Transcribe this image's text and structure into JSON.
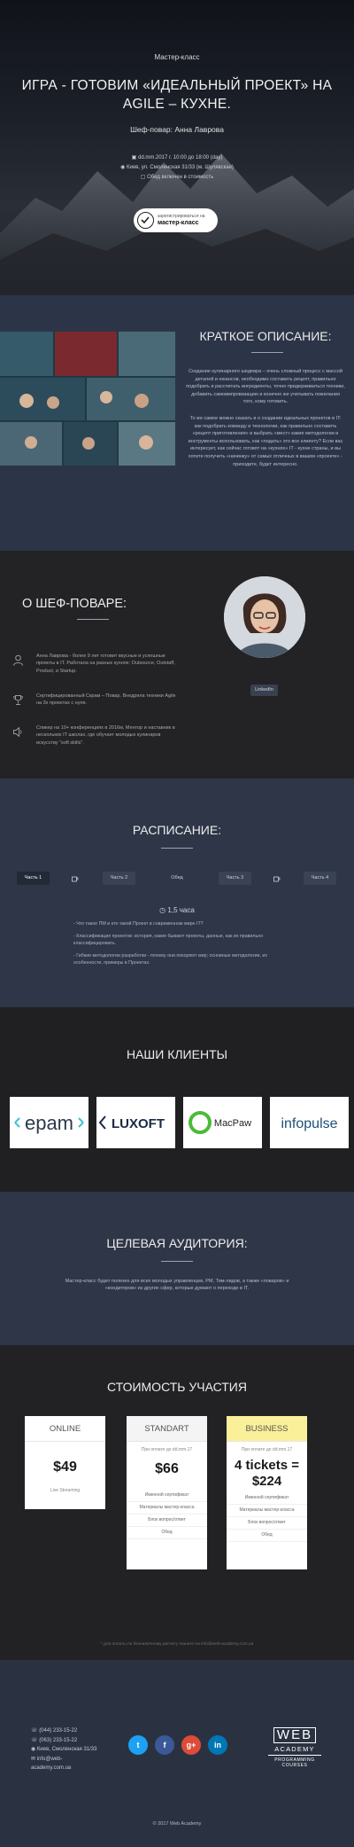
{
  "hero": {
    "kicker": "Мастер-класс",
    "title": "ИГРА - ГОТОВИМ «ИДЕАЛЬНЫЙ ПРОЕКТ» НА AGILE – КУХНЕ.",
    "chef": "Шеф-повар: Анна Лаврова",
    "datetime": "dd.mm.2017 г. 10:00 до 18:00 (day)",
    "location": "Киев, ул. Смоленская 31/33 (м. Шулявская)",
    "meal": "Обед включен в стоимость",
    "badge_small": "зарегистрироваться на",
    "badge_big": "мастер-класс"
  },
  "description": {
    "title": "КРАТКОЕ ОПИСАНИЕ:",
    "p1": "Создание кулинарного шедевра – очень сложный процесс с массой деталей и нюансов, необходимо составить рецепт, правильно подобрать и рассчитать ингредиенты, точно придерживаться техники, добавить самоимпровизацию и конечно же учитывать пожелания того, кому готовить.",
    "p2": "То же самое можно сказать и о создании идеальных проектов в IT: как подобрать команду и технологии, как правильно составить «рецепт приготовления» и выбрать «мест» какие методологии и инструменты использовать, как «подать» это все клиенту? Если вас интересует, как сейчас готовят на «кухнях» IT - кухне страны, и вы хотите получить «начинку» от самых отличных в вашем «проекте» - приходите, будет интересно."
  },
  "about": {
    "title": "О ШЕФ-ПОВАРЕ:",
    "items": [
      {
        "icon": "user-icon",
        "text": "Анна Лаврова - более 9 лет готовит вкусные и успешные проекты в IT. Работала на разных кухнях: Outsource, Outstaff, Product, и Startup."
      },
      {
        "icon": "trophy-icon",
        "text": "Сертифицированный Скрам – Повар. Внедряла техники Agile на 3х проектах с нуля."
      },
      {
        "icon": "speaker-icon",
        "text": "Спикер на 10+ конференциях в 2016м, Ментор и наставник в нескольких IT школах, где обучает молодых кулинаров искусству \"soft skills\"."
      }
    ],
    "linkedin": "LinkedIn"
  },
  "schedule": {
    "title": "РАСПИСАНИЕ:",
    "tabs": [
      "Часть 1",
      "Часть 2",
      "Обед",
      "Часть 3",
      "Часть 4"
    ],
    "duration": "1,5 часа",
    "points": [
      "- Что такое ПМ и кто такой Проект в современном мире IT?",
      "- Классификация проектов: история, какие бывают проекты, данные, как их правильно классифицировать.",
      "- Гибкие методологии разработки - почему они покоряют мир; основные методологии, их особенности, примеры в Проектах."
    ]
  },
  "clients": {
    "title": "НАШИ КЛИЕНТЫ",
    "logos": [
      "epam",
      "LUXOFT",
      "MacPaw",
      "infopulse"
    ]
  },
  "audience": {
    "title": "ЦЕЛЕВАЯ АУДИТОРИЯ:",
    "text": "Мастер-класс будет полезен для всех молодых управленцев, PM, Тим-лидов, а также «поваров» и «кондитеров» из других сфер, которые думают о переходе в IT."
  },
  "pricing": {
    "title": "СТОИМОСТЬ УЧАСТИЯ",
    "cards": [
      {
        "name": "ONLINE",
        "price": "$49",
        "sub": "Live Streaming",
        "note": "",
        "features": []
      },
      {
        "name": "STANDART",
        "price": "$66",
        "sub": "",
        "note": "При оплате до dd.mm.17",
        "features": [
          "Именной сертификат",
          "Материалы мастер-класса",
          "Блок вопрос/ответ",
          "Обед"
        ]
      },
      {
        "name": "BUSINESS",
        "price": "4 tickets = $224",
        "sub": "",
        "note": "При оплате до dd.mm.17",
        "features": [
          "Именной сертификат",
          "Материалы мастер-класса",
          "Блок вопрос/ответ",
          "Обед"
        ]
      }
    ],
    "footnote": "* для оплаты по безналичному расчету пишите на info@web-academy.com.ua"
  },
  "footer": {
    "phone1": "(044) 233-15-22",
    "phone2": "(063) 233-15-22",
    "address": "Киев, Смоленская 31/33",
    "email": "info@web-academy.com.ua",
    "brand_top": "WEB",
    "brand_mid": "ACADEMY",
    "brand_bottom": "PROGRAMMING COURSES",
    "copyright": "© 2017 Web Academy",
    "social": [
      "twitter-icon",
      "facebook-icon",
      "google-plus-icon",
      "linkedin-icon"
    ],
    "colors": {
      "twitter": "#1da1f2",
      "facebook": "#3b5998",
      "google": "#dd4b39",
      "linkedin": "#0077b5"
    }
  }
}
